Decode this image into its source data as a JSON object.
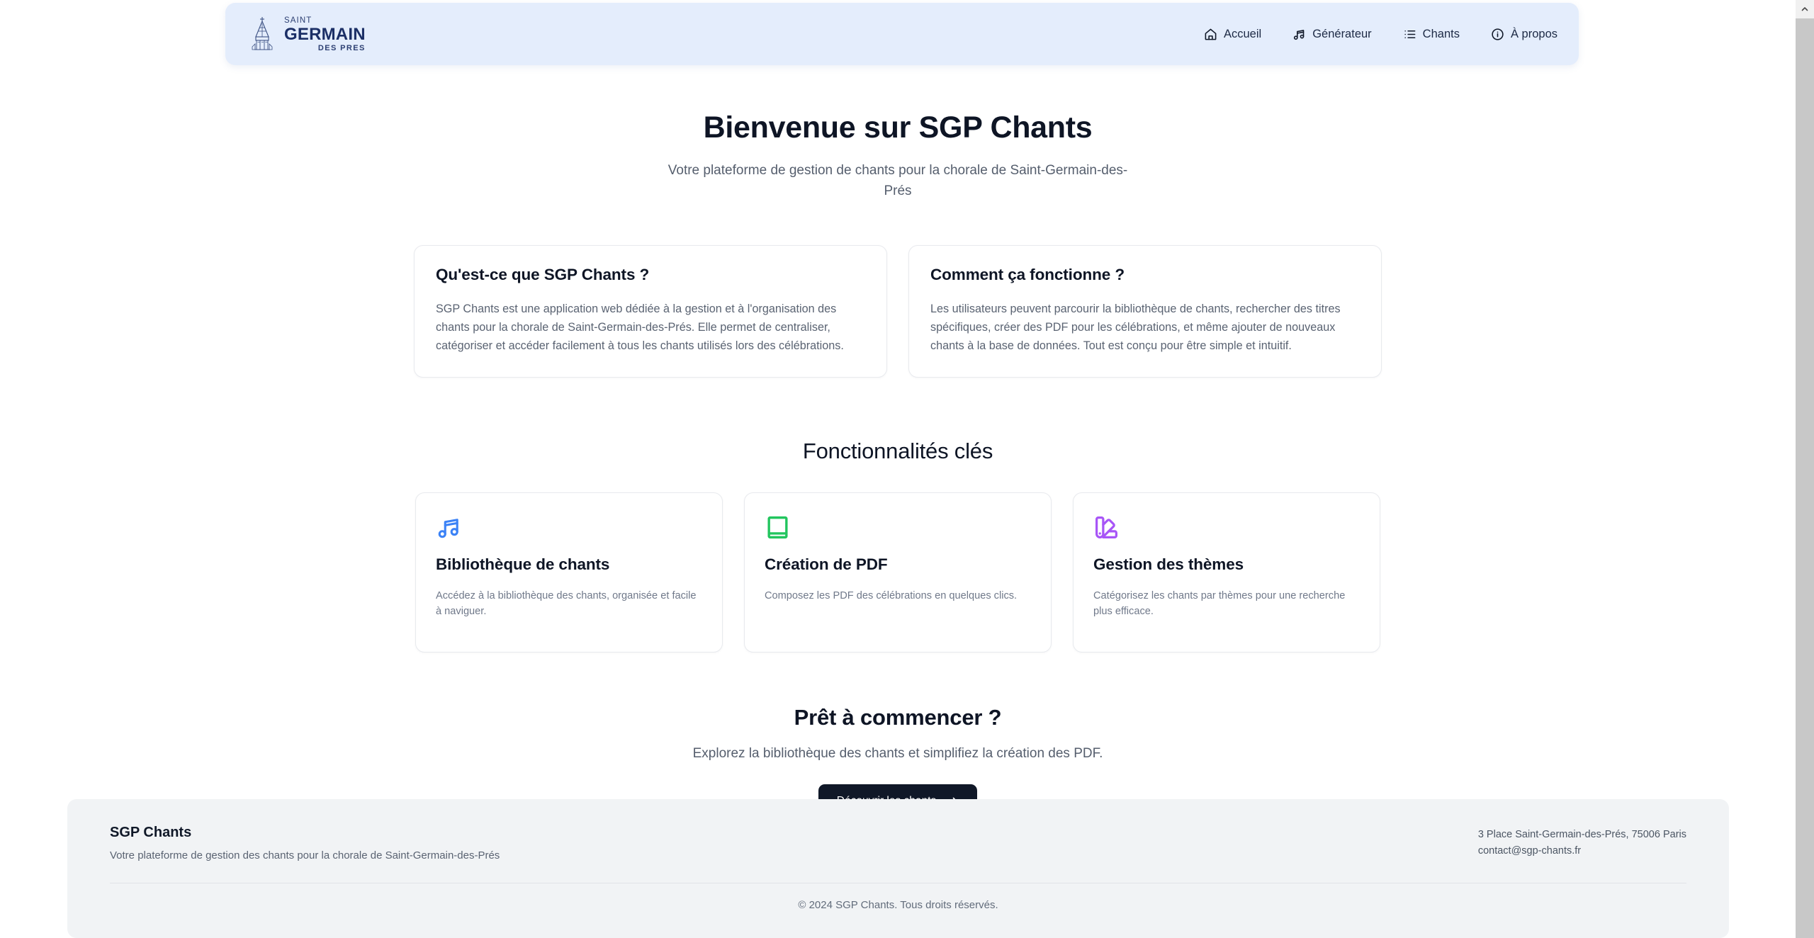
{
  "header": {
    "logo": {
      "icon": "church-tower-icon",
      "line1": "SAINT",
      "line2": "GERMAIN",
      "line3": "DES PRES"
    },
    "nav": [
      {
        "label": "Accueil",
        "icon": "home-icon"
      },
      {
        "label": "Générateur",
        "icon": "music-notes-icon"
      },
      {
        "label": "Chants",
        "icon": "list-icon"
      },
      {
        "label": "À propos",
        "icon": "info-circle-icon"
      }
    ]
  },
  "hero": {
    "title": "Bienvenue sur SGP Chants",
    "subtitle": "Votre plateforme de gestion de chants pour la chorale de Saint-Germain-des-Prés"
  },
  "intro_cards": [
    {
      "title": "Qu'est-ce que SGP Chants ?",
      "body": "SGP Chants est une application web dédiée à la gestion et à l'organisation des chants pour la chorale de Saint-Germain-des-Prés. Elle permet de centraliser, catégoriser et accéder facilement à tous les chants utilisés lors des célébrations."
    },
    {
      "title": "Comment ça fonctionne ?",
      "body": "Les utilisateurs peuvent parcourir la bibliothèque de chants, rechercher des titres spécifiques, créer des PDF pour les célébrations, et même ajouter de nouveaux chants à la base de données. Tout est conçu pour être simple et intuitif."
    }
  ],
  "features": {
    "title": "Fonctionnalités clés",
    "items": [
      {
        "icon": "music-notes-icon",
        "color": "#3b82f6",
        "title": "Bibliothèque de chants",
        "body": "Accédez à la bibliothèque des chants, organisée et facile à naviguer."
      },
      {
        "icon": "book-icon",
        "color": "#22c55e",
        "title": "Création de PDF",
        "body": "Composez les PDF des célébrations en quelques clics."
      },
      {
        "icon": "swatch-book-icon",
        "color": "#a855f7",
        "title": "Gestion des thèmes",
        "body": "Catégorisez les chants par thèmes pour une recherche plus efficace."
      }
    ]
  },
  "cta": {
    "title": "Prêt à commencer ?",
    "subtitle": "Explorez la bibliothèque des chants et simplifiez la création des PDF.",
    "button_label": "Découvrir les chants",
    "button_icon": "arrow-right-icon",
    "button_color": "#101828"
  },
  "footer": {
    "brand_title": "SGP Chants",
    "brand_tagline": "Votre plateforme de gestion des chants pour la chorale de Saint-Germain-des-Prés",
    "address": "3 Place Saint-Germain-des-Prés, 75006 Paris",
    "email": "contact@sgp-chants.fr",
    "copyright": "© 2024 SGP Chants. Tous droits réservés."
  },
  "colors": {
    "header_bg": "#e4edfc",
    "footer_bg": "#f1f3f5",
    "page_bg": "#ffffff",
    "logo_navy": "#1b2f66"
  }
}
